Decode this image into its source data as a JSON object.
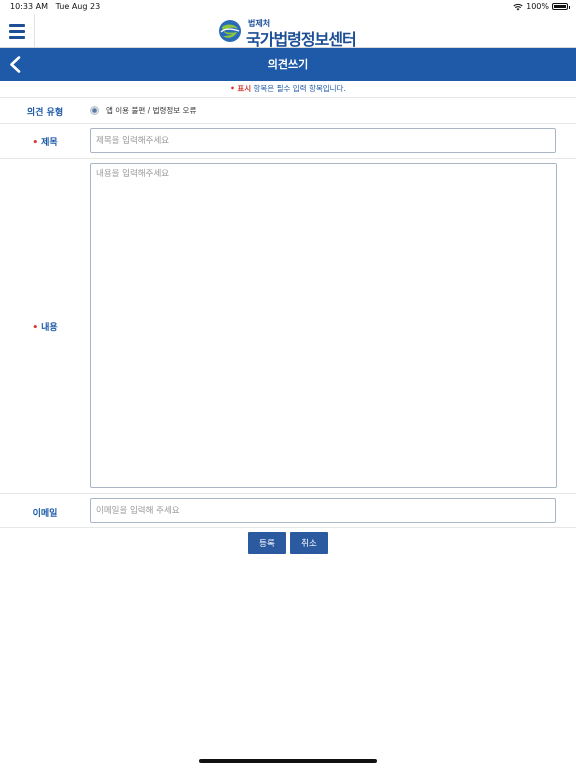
{
  "status_bar": {
    "time": "10:33 AM",
    "date": "Tue Aug 23",
    "battery": "100%"
  },
  "header": {
    "logo_sub": "법제처",
    "logo_main": "국가법령정보센터"
  },
  "title_bar": {
    "title": "의견쓰기"
  },
  "notice": {
    "mark": "•",
    "highlight": "표시",
    "text": " 항목은 필수 입력 항목입니다."
  },
  "form": {
    "type": {
      "label": "의견 유형",
      "option_label": "앱 이용 불편 / 법령정보 오류",
      "selected": true
    },
    "subject": {
      "required_mark": "•",
      "label": "제목",
      "placeholder": "제목을 입력해주세요"
    },
    "content": {
      "required_mark": "•",
      "label": "내용",
      "placeholder": "내용을 입력해주세요"
    },
    "email": {
      "label": "이메일",
      "placeholder": "이메일을 입력해 주세요"
    }
  },
  "buttons": {
    "submit": "등록",
    "cancel": "취소"
  },
  "colors": {
    "primary": "#1e5aa8",
    "required": "#d23a2f",
    "button": "#2c5aa0"
  },
  "icons": {
    "menu": "hamburger-menu-icon",
    "back": "chevron-left-icon",
    "wifi": "wifi-icon",
    "battery": "battery-icon"
  }
}
